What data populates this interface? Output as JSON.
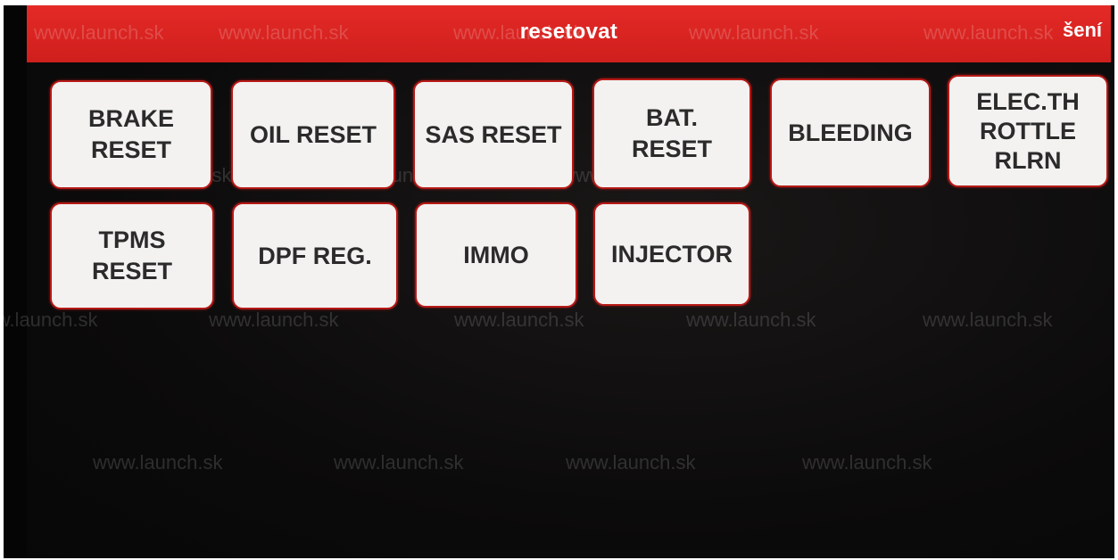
{
  "header": {
    "title": "resetovat",
    "right_label": "šení"
  },
  "buttons": [
    {
      "label": "BRAKE\nRESET"
    },
    {
      "label": "OIL RESET"
    },
    {
      "label": "SAS RESET"
    },
    {
      "label": "BAT.\nRESET"
    },
    {
      "label": "BLEEDING"
    },
    {
      "label": "ELEC.TH\nROTTLE\nRLRN"
    },
    {
      "label": "TPMS\nRESET"
    },
    {
      "label": "DPF REG."
    },
    {
      "label": "IMMO"
    },
    {
      "label": "INJECTOR"
    }
  ],
  "watermark": {
    "text": "www.launch.sk"
  },
  "colors": {
    "header": "#d9221f",
    "button_border": "#b71916",
    "button_face": "#f3f2f0",
    "background": "#0b0a0a"
  }
}
